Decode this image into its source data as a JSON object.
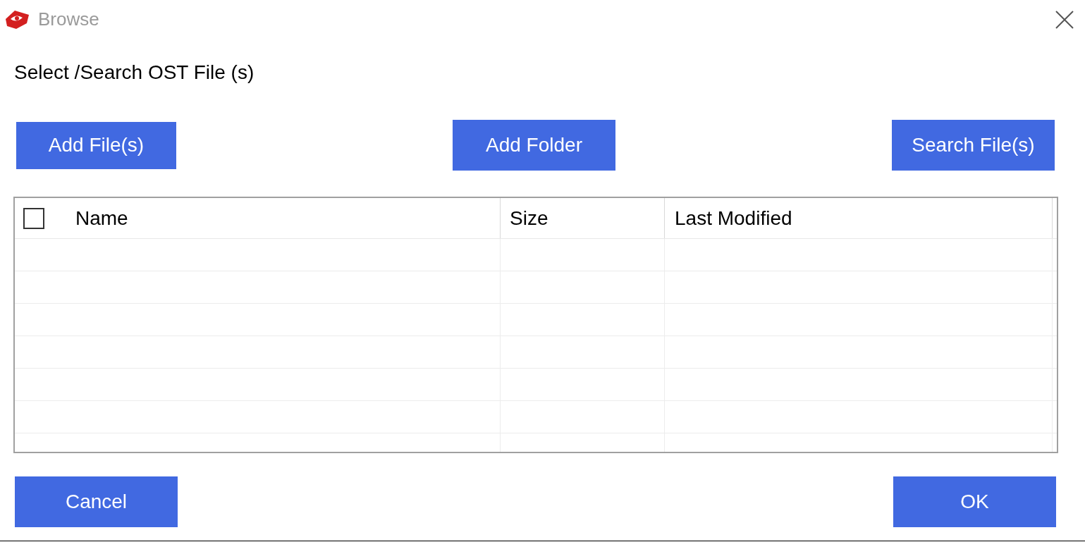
{
  "window": {
    "title": "Browse"
  },
  "heading": "Select /Search OST File (s)",
  "top_buttons": [
    "Add File(s)",
    "Add Folder",
    "Search File(s)"
  ],
  "table": {
    "select_all": {
      "checked": false
    },
    "columns": [
      "Name",
      "Size",
      "Last Modified"
    ]
  },
  "bottom_buttons": [
    "Cancel",
    "OK"
  ]
}
